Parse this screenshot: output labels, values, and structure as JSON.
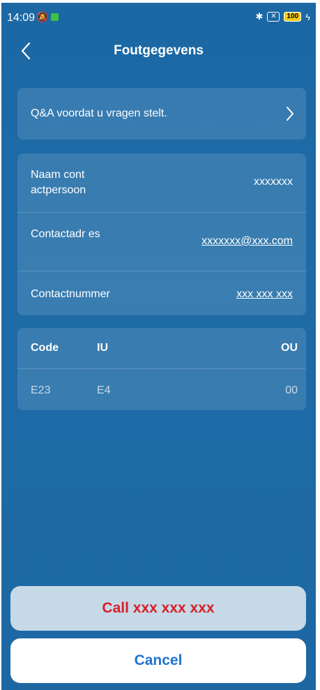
{
  "status_bar": {
    "time": "14:09",
    "mute_icon": "mute-icon",
    "bluetooth_icon": "bluetooth-icon",
    "battery_level": "100"
  },
  "header": {
    "title": "Foutgegevens",
    "back_icon": "chevron-left-icon"
  },
  "qa": {
    "label": "Q&A voordat u vragen stelt."
  },
  "contact": {
    "rows": [
      {
        "label": "Naam cont actpersoon",
        "value": "xxxxxxx"
      },
      {
        "label": "Contactadr es",
        "value": "xxxxxxx@xxx.com"
      },
      {
        "label": "Contactnummer",
        "value": "xxx xxx xxx"
      }
    ]
  },
  "codes": {
    "headers": [
      "Code",
      "IU",
      "OU"
    ],
    "row": [
      "E23",
      "E4",
      "00"
    ]
  },
  "actions": {
    "call_label": "Call xxx xxx xxx",
    "cancel_label": "Cancel"
  },
  "colors": {
    "background": "#1d6aa6",
    "call_text": "#d72029",
    "cancel_text": "#1f74d2"
  }
}
